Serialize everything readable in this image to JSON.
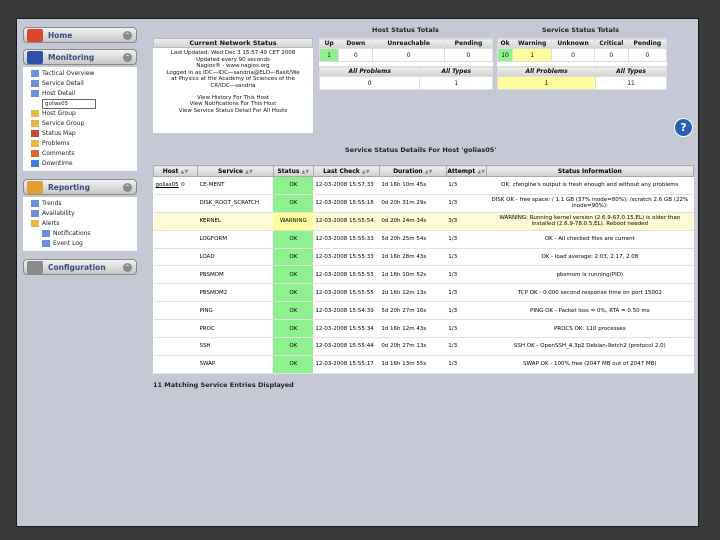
{
  "sidebar": {
    "home": {
      "label": "Home",
      "toggle": "⌃"
    },
    "monitoring": {
      "label": "Monitoring",
      "toggle": "⌃",
      "items": [
        "Tactical Overview",
        "Service Detail",
        "Host Detail",
        "Host Group",
        "Service Group",
        "Status Map",
        "Problems",
        "Comments",
        "Downtime"
      ],
      "search_value": "golias05"
    },
    "reporting": {
      "label": "Reporting",
      "toggle": "⌃",
      "items": [
        "Trends",
        "Availability",
        "Alerts",
        "Notifications",
        "Event Log"
      ]
    },
    "configuration": {
      "label": "Configuration",
      "toggle": "⌃"
    }
  },
  "network_status": {
    "title": "Current Network Status",
    "lines": [
      "Last Updated: Wed Dec 3 15:57:49 CET 2008",
      "Updated every 90 seconds",
      "Nagios® - www.nagios.org",
      "Logged in as IDC—IDC—sandria@ELD—Basit/We",
      "at Physics at the Academy of Sciences of the",
      "CR/IDC—sandria"
    ],
    "links": [
      "View History For This Host",
      "View Notifications For This Host",
      "View Service Status Detail For All Hosts"
    ]
  },
  "host_totals": {
    "title": "Host Status Totals",
    "headers": [
      "Up",
      "Down",
      "Unreachable",
      "Pending"
    ],
    "values": [
      "1",
      "0",
      "0",
      "0"
    ],
    "sub_headers": [
      "All Problems",
      "All Types"
    ],
    "sub_values": [
      "0",
      "1"
    ]
  },
  "service_totals": {
    "title": "Service Status Totals",
    "headers": [
      "Ok",
      "Warning",
      "Unknown",
      "Critical",
      "Pending"
    ],
    "values": [
      "10",
      "1",
      "0",
      "0",
      "0"
    ],
    "sub_headers": [
      "All Problems",
      "All Types"
    ],
    "sub_values": [
      "1",
      "11"
    ]
  },
  "details_title": "Service Status Details For Host 'golias05'",
  "columns": [
    "Host",
    "Service",
    "Status",
    "Last Check",
    "Duration",
    "Attempt",
    "Status Information"
  ],
  "rows": [
    {
      "host": "golias05",
      "service": "CE-MENT",
      "status": "OK",
      "check": "12-03-2008 15:57:33",
      "duration": "1d 16h 10m 45s",
      "attempt": "1/3",
      "info": "OK: cfengine's output is fresh enough and without any problems"
    },
    {
      "host": "",
      "service": "DISK_ROOT_SCRATCH",
      "status": "OK",
      "check": "12-03-2008 15:55:18",
      "duration": "0d 20h 31m 29s",
      "attempt": "1/3",
      "info": "DISK OK - free space: / 1.1 GB (37% inode=80%); /scratch 2.6 GB (22% inode=90%):"
    },
    {
      "host": "",
      "service": "KERNEL",
      "status": "WARNING",
      "check": "12-03-2008 15:55:54",
      "duration": "0d 20h 24m 34s",
      "attempt": "3/3",
      "info": "WARNING: Running kernel version (2.6.9-67.0.15.EL) is older than installed (2.6.9-78.0.5.EL). Reboot needed"
    },
    {
      "host": "",
      "service": "LOGFORM",
      "status": "OK",
      "check": "12-03-2008 15:55:33",
      "duration": "5d 20h 25m 54s",
      "attempt": "1/3",
      "info": "OK - All checked files are current"
    },
    {
      "host": "",
      "service": "LOAD",
      "status": "OK",
      "check": "12-03-2008 15:55:33",
      "duration": "1d 16h 28m 43s",
      "attempt": "1/3",
      "info": "OK - load average: 2.03, 2.17, 2.08"
    },
    {
      "host": "",
      "service": "PBSMOM",
      "status": "OK",
      "check": "12-03-2008 15:55:53",
      "duration": "1d 16h 10m 52s",
      "attempt": "1/3",
      "info": "pbsmom is running(PID)"
    },
    {
      "host": "",
      "service": "PBSMOM2",
      "status": "OK",
      "check": "12-03-2008 15:55:55",
      "duration": "1d 16h 12m 13s",
      "attempt": "1/3",
      "info": "TCP OK - 0.000 second response time on port 15002"
    },
    {
      "host": "",
      "service": "PING",
      "status": "OK",
      "check": "12-03-2008 15:54:39",
      "duration": "5d 20h 27m 16s",
      "attempt": "1/3",
      "info": "PING OK - Packet loss = 0%, RTA = 0.50 ms"
    },
    {
      "host": "",
      "service": "PROC",
      "status": "OK",
      "check": "12-03-2008 15:55:34",
      "duration": "1d 16h 12m 43s",
      "attempt": "1/3",
      "info": "PROCS OK: 110 processes"
    },
    {
      "host": "",
      "service": "SSH",
      "status": "OK",
      "check": "12-03-2008 15:55:44",
      "duration": "0d 20h 27m 13s",
      "attempt": "1/3",
      "info": "SSH OK - OpenSSH_4.3p2 Debian-9etch2 (protocol 2.0)"
    },
    {
      "host": "",
      "service": "SWAP",
      "status": "OK",
      "check": "12-03-2008 15:55:17",
      "duration": "1d 16h 13m 55s",
      "attempt": "1/3",
      "info": "SWAP OK - 100% free (2047 MB out of 2047 MB)"
    }
  ],
  "footer": "11 Matching Service Entries Displayed",
  "colors": {
    "ok": "#8ef08e",
    "warning": "#fffc9b",
    "frame": "#c5c9d6"
  }
}
